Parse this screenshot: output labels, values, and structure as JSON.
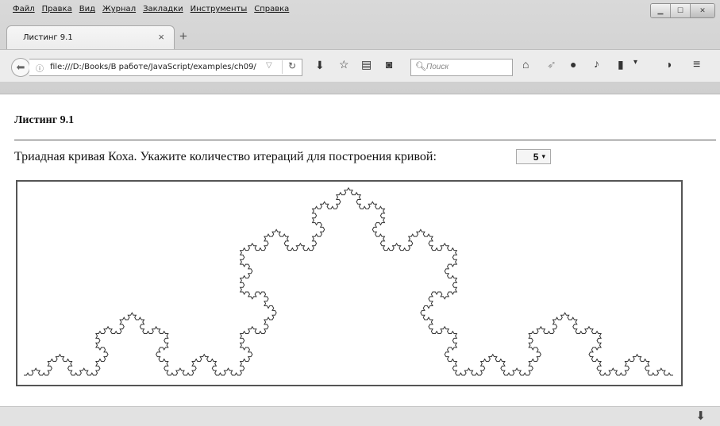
{
  "menu": [
    "Файл",
    "Правка",
    "Вид",
    "Журнал",
    "Закладки",
    "Инструменты",
    "Справка"
  ],
  "tab": {
    "title": "Листинг 9.1"
  },
  "address": {
    "url": "file:///D:/Books/В работе/JavaScript/examples/ch09/",
    "search_placeholder": "Поиск"
  },
  "icons": {
    "back": "back-arrow-icon",
    "info": "info-icon",
    "reload": "reload-icon",
    "download": "download-icon",
    "bookmark": "star-icon",
    "reading": "reading-list-icon",
    "pocket": "pocket-icon",
    "home": "home-icon",
    "share": "share-icon",
    "chat": "chat-icon",
    "menu": "hamburger-icon"
  },
  "page": {
    "heading": "Листинг 9.1",
    "prompt": "Триадная кривая Коха. Укажите количество итераций для построения кривой:",
    "iterations": "5",
    "selected_iterations": 5
  }
}
